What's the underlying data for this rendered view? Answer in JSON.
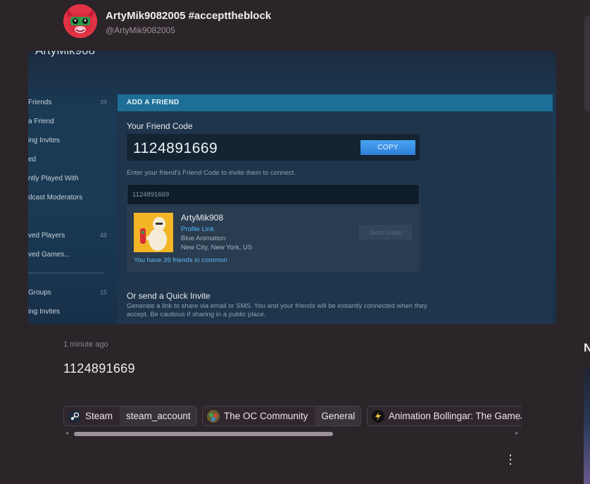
{
  "post": {
    "author_name": "ArtyMik9082005 #accepttheblock",
    "author_handle": "@ArtyMik9082005",
    "timestamp": "1 minute ago",
    "text": "1124891669"
  },
  "screenshot": {
    "top_name": "ArtyMik908",
    "nav": [
      {
        "label": "Friends",
        "count": "39"
      },
      {
        "label": "a Friend",
        "count": ""
      },
      {
        "label": "ing Invites",
        "count": ""
      },
      {
        "label": "ed",
        "count": ""
      },
      {
        "label": "ntly Played With",
        "count": ""
      },
      {
        "label": "dcast Moderators",
        "count": ""
      },
      {
        "label": "",
        "count": ""
      },
      {
        "label": "ved Players",
        "count": "48"
      },
      {
        "label": "ved Games...",
        "count": ""
      }
    ],
    "nav_bottom": [
      {
        "label": "Groups",
        "count": "15"
      },
      {
        "label": "ing Invites",
        "count": ""
      }
    ],
    "panel_header": "ADD A FRIEND",
    "friend_code_title": "Your Friend Code",
    "friend_code": "1124891669",
    "copy_label": "COPY",
    "hint": "Enter your friend's Friend Code to invite them to connect.",
    "input_value": "1124891669",
    "result": {
      "name": "ArtyMik908",
      "link": "Profile Link",
      "line1": "Blue Animation",
      "line2": "New City, New York, US",
      "send_invite": "Send Invite",
      "common": "You have 39 friends in common"
    },
    "quick_invite_title": "Or send a Quick Invite",
    "quick_invite_desc": "Generate a link to share via email or SMS. You and your friends will be instantly connected when they accept. Be cautious if sharing in a public place."
  },
  "tags": [
    {
      "label": "Steam",
      "sub": "steam_account",
      "icon": "steam-icon"
    },
    {
      "label": "The OC Community",
      "sub": "General",
      "icon": "community-icon"
    },
    {
      "label": "Animation Bollingar: The GameJolt d",
      "sub": "",
      "icon": "gamejolt-icon"
    }
  ],
  "sidebar_right": {
    "heading_partial": "N"
  },
  "colors": {
    "background": "#2b2429",
    "steam_accent": "#1d6f98",
    "copy_button": "#3b8fe6",
    "link_blue": "#4fb7ff"
  }
}
